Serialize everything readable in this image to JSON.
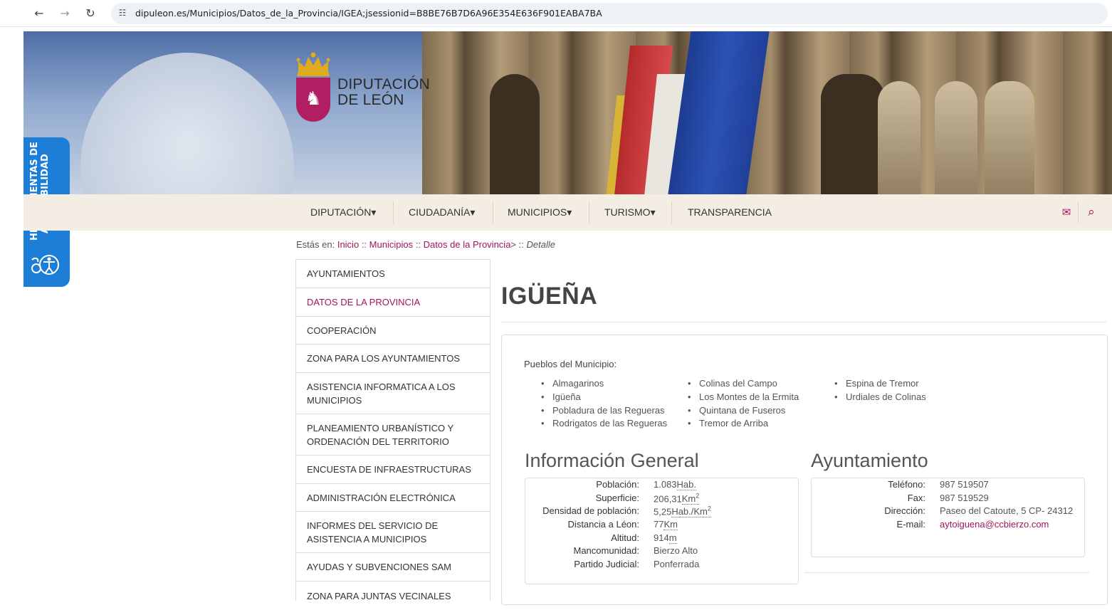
{
  "browser": {
    "url": "dipuleon.es/Municipios/Datos_de_la_Provincia/IGEA;jsessionid=B8BE76B7D6A96E354E636F901EABA7BA",
    "back_icon": "←",
    "forward_icon": "→",
    "reload_icon": "↻",
    "site_info_icon": "☷"
  },
  "logo": {
    "line1": "DIPUTACIÓN",
    "line2": "DE LEÓN",
    "lion_glyph": "♞",
    "color": "#b11f63"
  },
  "accessibility": {
    "label_line1": "HERRAMIENTAS DE",
    "label_line2": "ACCESIBILIDAD",
    "arrow": "◀",
    "color": "#1c7ed6"
  },
  "nav": {
    "items": [
      "DIPUTACIÓN",
      "CIUDADANÍA",
      "MUNICIPIOS",
      "TURISMO",
      "TRANSPARENCIA"
    ],
    "dropdown_caret": "▾",
    "mail_icon": "✉",
    "search_icon": "⌕"
  },
  "breadcrumb": {
    "prefix": "Estás en:",
    "inicio": "Inicio",
    "sep1": "::",
    "municipios": "Municipios",
    "sep2": "::",
    "datos": "Datos de la Provincia",
    "gt": ">",
    "sep3": "::",
    "current": "Detalle"
  },
  "sidebar": {
    "items": [
      "AYUNTAMIENTOS",
      "DATOS DE LA PROVINCIA",
      "COOPERACIÓN",
      "ZONA PARA LOS AYUNTAMIENTOS",
      "ASISTENCIA INFORMATICA A LOS MUNICIPIOS",
      "PLANEAMIENTO URBANÍSTICO Y ORDENACIÓN DEL TERRITORIO",
      "ENCUESTA DE INFRAESTRUCTURAS",
      "ADMINISTRACIÓN ELECTRÓNICA",
      "INFORMES DEL SERVICIO DE ASISTENCIA A MUNICIPIOS",
      "AYUDAS Y SUBVENCIONES SAM",
      "ZONA PARA JUNTAS VECINALES"
    ],
    "active_index": 1
  },
  "page": {
    "title": "IGÜEÑA",
    "pueblos_label": "Pueblos del Municipio:",
    "pueblos": [
      "Almagarinos",
      "Igüeña",
      "Pobladura de las Regueras",
      "Rodrigatos de las Regueras",
      "Colinas del Campo",
      "Los Montes de la Ermita",
      "Quintana de Fuseros",
      "Tremor de Arriba",
      "Espina de Tremor",
      "Urdiales de Colinas"
    ]
  },
  "info_general": {
    "title": "Información General",
    "rows": [
      {
        "label": "Población:",
        "value": "1.083",
        "unit": "Hab."
      },
      {
        "label": "Superficie:",
        "value": "206,31",
        "unit": "Km",
        "sup": "2"
      },
      {
        "label": "Densidad de población:",
        "value": "5,25",
        "unit": "Hab./Km",
        "sup": "2"
      },
      {
        "label": "Distancia a Léon:",
        "value": "77",
        "unit": "Km"
      },
      {
        "label": "Altitud:",
        "value": "914",
        "unit": "m"
      },
      {
        "label": "Mancomunidad:",
        "value": "Bierzo Alto",
        "unit": ""
      },
      {
        "label": "Partido Judicial:",
        "value": "Ponferrada",
        "unit": ""
      }
    ]
  },
  "ayuntamiento": {
    "title": "Ayuntamiento",
    "rows": [
      {
        "label": "Teléfono:",
        "value": "987 519507"
      },
      {
        "label": "Fax:",
        "value": "987 519529"
      },
      {
        "label": "Dirección:",
        "value": "Paseo del Catoute, 5 CP- 24312"
      },
      {
        "label": "E-mail:",
        "value": "aytoiguena@ccbierzo.com"
      }
    ]
  },
  "colors": {
    "accent": "#a1155c",
    "nav_bg": "#f4ede4"
  }
}
